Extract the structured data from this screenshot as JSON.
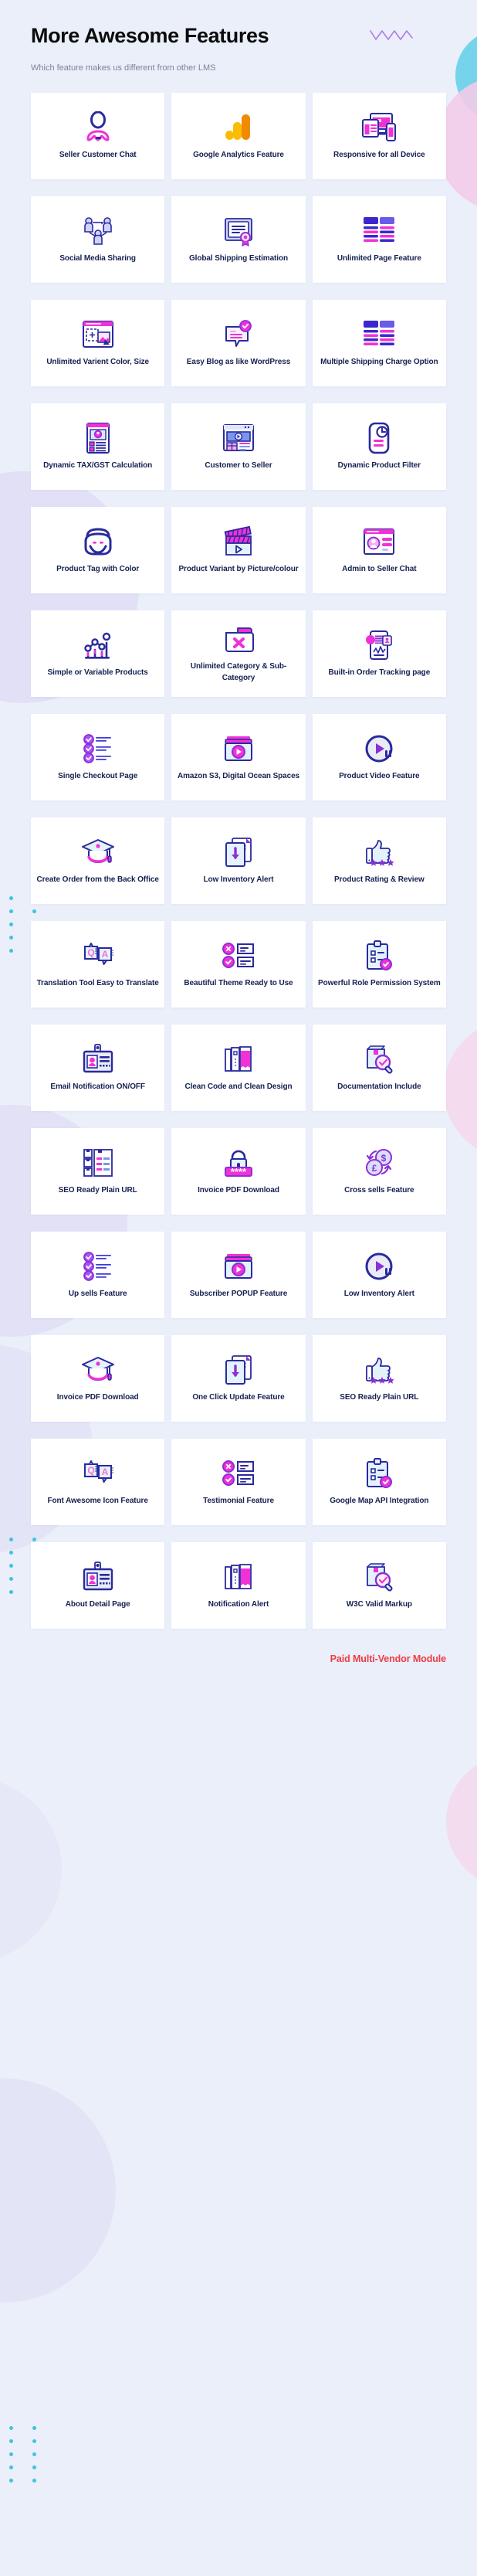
{
  "header": {
    "title": "More Awesome Features",
    "subtitle": "Which feature makes us different from other LMS"
  },
  "decor": {
    "zigzag_icon": "zigzag-icon",
    "circle_cyan": "#6fd2ea",
    "circle_pink": "#f3cbe8",
    "circle_lilac": "#d9d4f2",
    "dot_color": "#3fc3e0",
    "dot_grid_icon": "dot-grid-icon"
  },
  "colors": {
    "background": "#eaeffa",
    "card_background": "#ffffff",
    "label": "#152151",
    "title": "#0c0c0c",
    "subtitle": "#7b8399",
    "footer_accent": "#ef3b43",
    "icon_indigo": "#2a2a9e",
    "icon_magenta": "#f031d8",
    "icon_purple": "#8b2fd6",
    "icon_light": "#dff0fb"
  },
  "features": [
    {
      "label": "Seller Customer Chat",
      "icon": "seller-customer-chat-icon"
    },
    {
      "label": "Google Analytics Feature",
      "icon": "google-analytics-icon"
    },
    {
      "label": "Responsive for all Device",
      "icon": "responsive-devices-icon"
    },
    {
      "label": "Social Media Sharing",
      "icon": "social-share-icon"
    },
    {
      "label": "Global Shipping Estimation",
      "icon": "certificate-icon"
    },
    {
      "label": "Unlimited Page Feature",
      "icon": "table-rows-icon"
    },
    {
      "label": "Unlimited Varient Color, Size",
      "icon": "image-upload-icon"
    },
    {
      "label": "Easy Blog as like WordPress",
      "icon": "chat-check-icon"
    },
    {
      "label": "Multiple Shipping Charge Option",
      "icon": "table-rows-icon"
    },
    {
      "label": "Dynamic TAX/GST Calculation",
      "icon": "profile-form-icon"
    },
    {
      "label": "Customer to Seller",
      "icon": "browser-video-icon"
    },
    {
      "label": "Dynamic Product Filter",
      "icon": "document-clock-icon"
    },
    {
      "label": "Product Tag with Color",
      "icon": "tag-face-icon"
    },
    {
      "label": "Product Variant by Picture/colour",
      "icon": "clapperboard-icon"
    },
    {
      "label": "Admin to Seller Chat",
      "icon": "browser-profile-icon"
    },
    {
      "label": "Simple or Variable Products",
      "icon": "chart-nodes-icon"
    },
    {
      "label": "Unlimited Category & Sub-Category",
      "icon": "folder-x-icon"
    },
    {
      "label": "Built-in Order Tracking page",
      "icon": "mobile-tracking-icon"
    },
    {
      "label": "Single Checkout Page",
      "icon": "checklist-icon"
    },
    {
      "label": "Amazon S3, Digital Ocean Spaces",
      "icon": "media-folder-play-icon"
    },
    {
      "label": "Product Video Feature",
      "icon": "play-pause-icon"
    },
    {
      "label": "Create Order from the Back Office",
      "icon": "graduation-cap-icon"
    },
    {
      "label": "Low Inventory Alert",
      "icon": "file-download-icon"
    },
    {
      "label": "Product Rating & Review",
      "icon": "thumbs-up-stars-icon"
    },
    {
      "label": "Translation Tool Easy to Translate",
      "icon": "qa-translate-icon"
    },
    {
      "label": "Beautiful Theme Ready to Use",
      "icon": "survey-options-icon"
    },
    {
      "label": "Powerful Role Permission System",
      "icon": "clipboard-check-icon"
    },
    {
      "label": "Email Notification ON/OFF",
      "icon": "id-card-icon"
    },
    {
      "label": "Clean Code and Clean Design",
      "icon": "files-stack-icon"
    },
    {
      "label": "Documentation Include",
      "icon": "box-search-icon"
    },
    {
      "label": "SEO Ready Plain URL",
      "icon": "boxes-list-icon"
    },
    {
      "label": "Invoice PDF Download",
      "icon": "lock-password-icon"
    },
    {
      "label": "Cross sells Feature",
      "icon": "currency-exchange-icon"
    },
    {
      "label": "Up sells Feature",
      "icon": "checklist-icon"
    },
    {
      "label": "Subscriber POPUP Feature",
      "icon": "media-folder-play-icon"
    },
    {
      "label": "Low Inventory Alert",
      "icon": "play-pause-icon"
    },
    {
      "label": "Invoice PDF Download",
      "icon": "graduation-cap-icon"
    },
    {
      "label": "One Click Update Feature",
      "icon": "file-download-icon"
    },
    {
      "label": "SEO Ready Plain URL",
      "icon": "thumbs-up-stars-icon"
    },
    {
      "label": "Font Awesome Icon Feature",
      "icon": "qa-translate-icon"
    },
    {
      "label": "Testimonial Feature",
      "icon": "survey-options-icon"
    },
    {
      "label": "Google Map API Integration",
      "icon": "clipboard-check-icon"
    },
    {
      "label": "About Detail Page",
      "icon": "id-card-icon"
    },
    {
      "label": "Notification Alert",
      "icon": "files-stack-icon"
    },
    {
      "label": "W3C Valid Markup",
      "icon": "box-search-icon"
    }
  ],
  "footer": {
    "note": "Paid Multi-Vendor Module"
  }
}
